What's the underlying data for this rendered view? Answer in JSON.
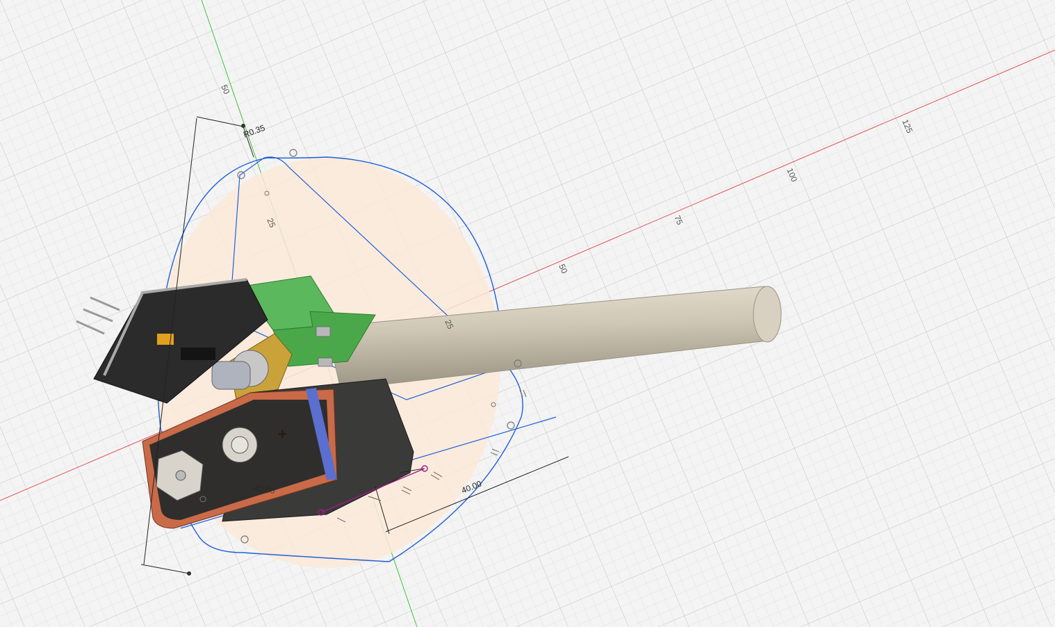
{
  "canvas": {
    "background": "#f4f4f4",
    "grid_minor_color": "#dcdcdc",
    "grid_major_color": "#c8c8c8"
  },
  "axes": {
    "x_color": "#e05050",
    "y_color": "#3cc43c",
    "x_tick_labels": [
      "25",
      "50",
      "75",
      "100",
      "125"
    ],
    "y_tick_labels": [
      "25",
      "50"
    ]
  },
  "sketch": {
    "profile_color": "#1e5fd8",
    "fill_color": "#fbe9d8",
    "constraint_color": "#a01a8a"
  },
  "dimensions": {
    "radius_label": "R0.35",
    "width_label": "40.00",
    "height_label": "40.00"
  },
  "parts": {
    "rod_color": "#c9c0ac",
    "bracket_color": "#5cb85c",
    "battery_body_color": "#3a3a38",
    "battery_accent_color": "#c96a48",
    "battery_band_color": "#5a6fcf",
    "board_color": "#2b2b2b",
    "switch_color": "#c9a23a"
  }
}
